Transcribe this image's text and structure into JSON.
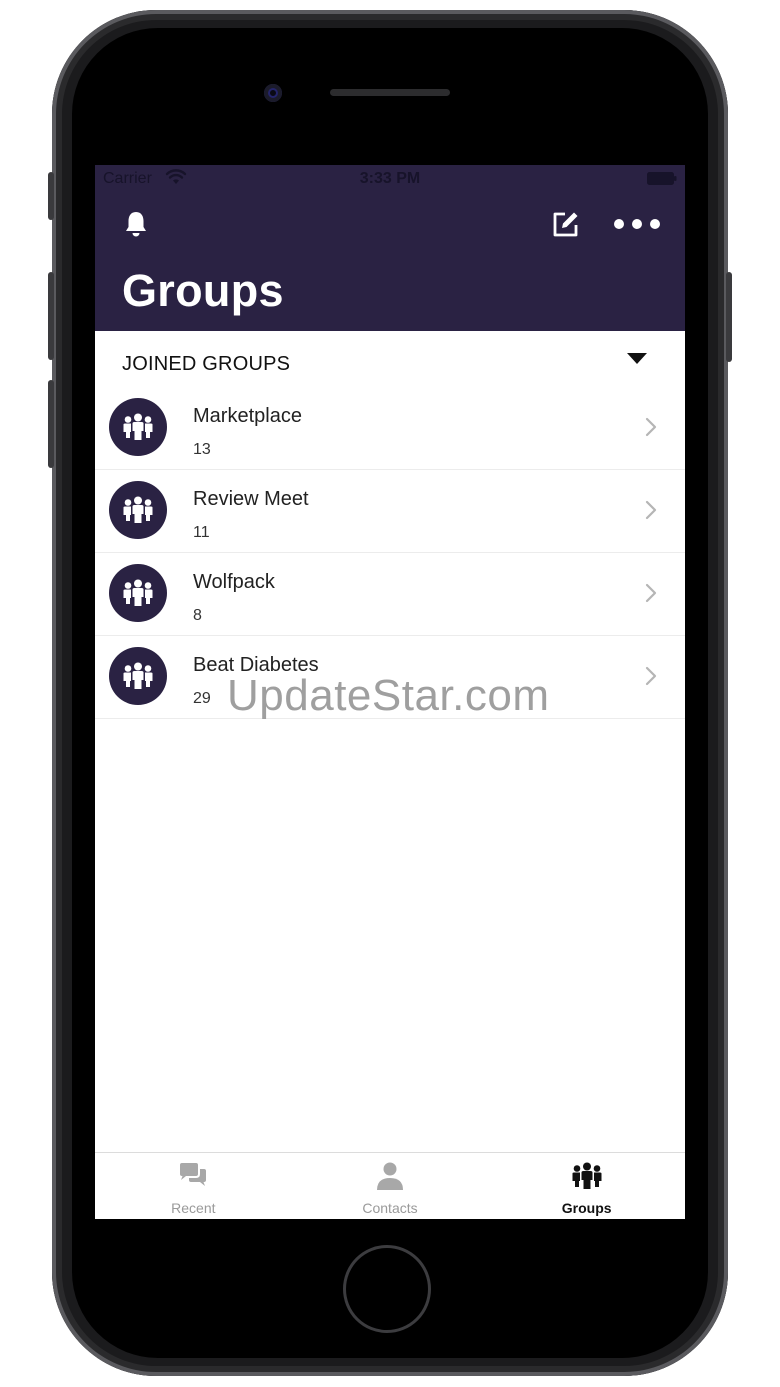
{
  "status_bar": {
    "carrier": "Carrier",
    "time": "3:33 PM"
  },
  "header": {
    "title": "Groups",
    "background_color": "#2a2243",
    "icons": [
      "bell-icon",
      "compose-icon",
      "more-icon"
    ]
  },
  "section": {
    "title": "JOINED GROUPS"
  },
  "groups": [
    {
      "name": "Marketplace",
      "count": "13"
    },
    {
      "name": "Review Meet",
      "count": "11"
    },
    {
      "name": "Wolfpack",
      "count": "8"
    },
    {
      "name": "Beat Diabetes",
      "count": "29"
    }
  ],
  "watermark": "UpdateStar.com",
  "tabs": [
    {
      "label": "Recent",
      "icon": "chat-bubbles-icon",
      "active": false
    },
    {
      "label": "Contacts",
      "icon": "person-icon",
      "active": false
    },
    {
      "label": "Groups",
      "icon": "group-icon",
      "active": true
    }
  ]
}
